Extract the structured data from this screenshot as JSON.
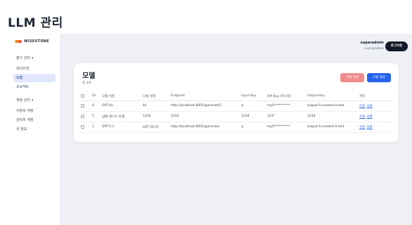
{
  "page": {
    "title": "LLM 관리"
  },
  "sidebar": {
    "logo": "WISESTONE",
    "groups": [
      {
        "label": "평가 관리"
      },
      {
        "label": "계정 관리"
      }
    ],
    "items": [
      {
        "label": "데이터셋"
      },
      {
        "label": "모델"
      },
      {
        "label": "프로젝트"
      },
      {
        "label": "사용자 계정"
      },
      {
        "label": "관리자 계정"
      },
      {
        "label": "내 정보"
      }
    ]
  },
  "header": {
    "user_name": "superadmin",
    "user_email": "super@admin",
    "logout_label": "로그아웃"
  },
  "main": {
    "title": "모델",
    "count": "총 3개",
    "delete_label": "모델 삭제",
    "add_label": "모델 생성",
    "columns": [
      "",
      "ID",
      "모델 이름",
      "모델 설명",
      "Endpoint",
      "Input Key",
      "API Key (마스킹)",
      "Output Key",
      "관리"
    ],
    "rows": [
      {
        "id": "6",
        "name": "GPT-4o",
        "desc": "4o",
        "endpoint": "http://localhost:8001/generate2",
        "input_key": "q",
        "api_key": "myS**********",
        "output_key": "output.0.content.0.text",
        "edit": "수정",
        "delete": "삭제"
      },
      {
        "id": "5",
        "name": "상태 테스트 모델",
        "desc": "1234",
        "endpoint": "1234",
        "input_key": "1234",
        "api_key": "123*",
        "output_key": "1234",
        "edit": "수정",
        "delete": "삭제"
      },
      {
        "id": "1",
        "name": "GPT-5.1",
        "desc": "GPT 테스트",
        "endpoint": "http://localhost:8001/generate",
        "input_key": "q",
        "api_key": "myS**********",
        "output_key": "output.0.content.0.text",
        "edit": "수정",
        "delete": "삭제"
      }
    ]
  },
  "colors": {
    "accent": "#2563eb",
    "danger": "#f18b8b",
    "active_nav": "#e0e7ff",
    "background": "#eef0f5"
  }
}
